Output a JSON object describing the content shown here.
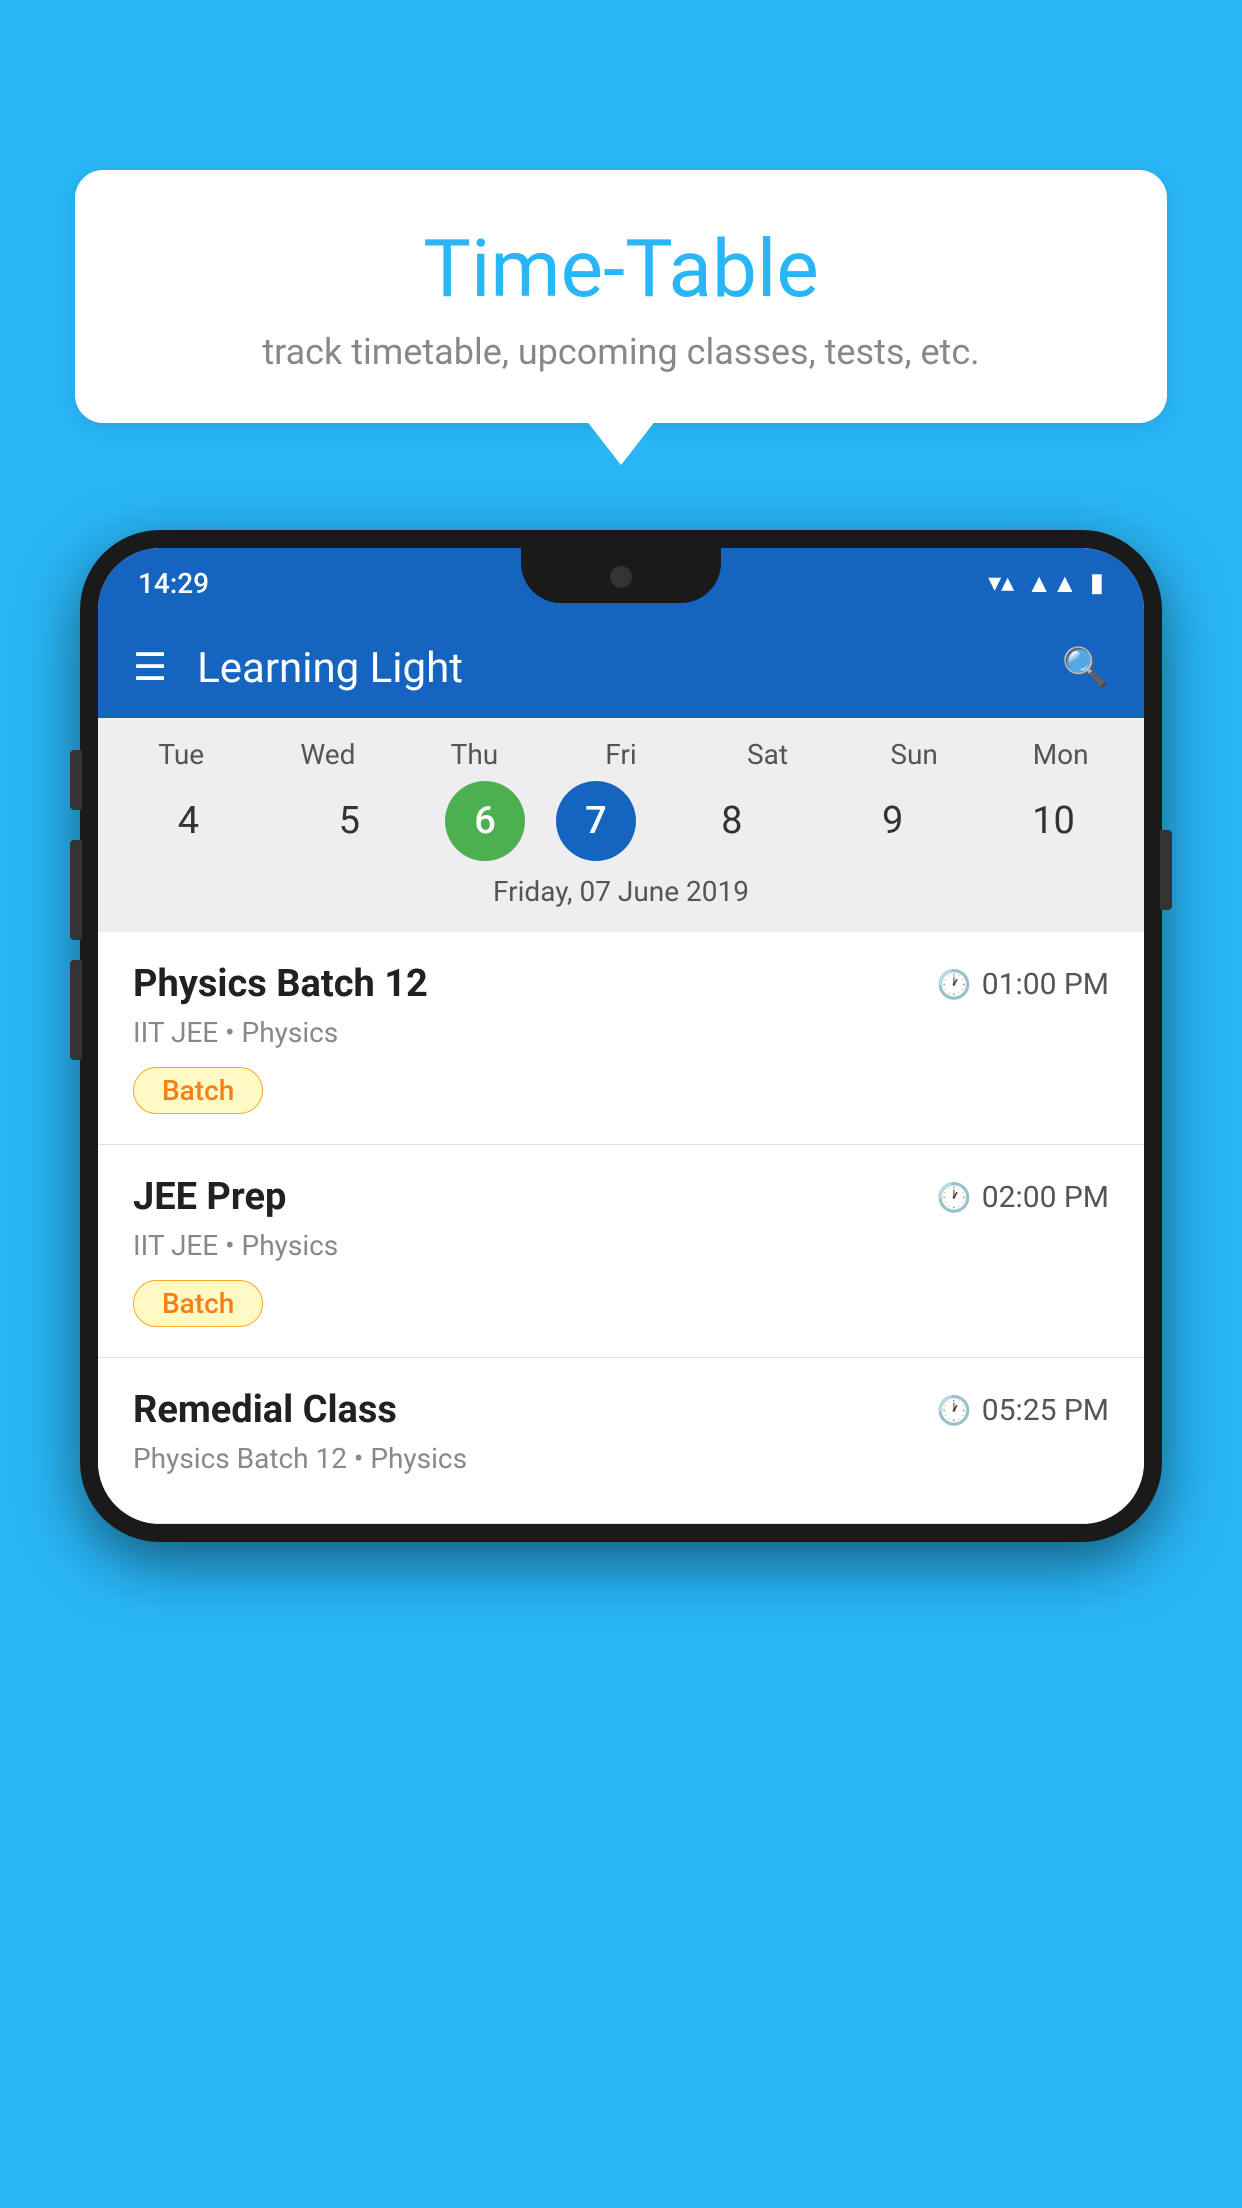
{
  "background_color": "#29B6F6",
  "bubble": {
    "title": "Time-Table",
    "subtitle": "track timetable, upcoming classes, tests, etc."
  },
  "phone": {
    "status_bar": {
      "time": "14:29",
      "icons": [
        "wifi",
        "signal",
        "battery"
      ]
    },
    "app_bar": {
      "title": "Learning Light"
    },
    "calendar": {
      "day_labels": [
        "Tue",
        "Wed",
        "Thu",
        "Fri",
        "Sat",
        "Sun",
        "Mon"
      ],
      "day_numbers": [
        "4",
        "5",
        "6",
        "7",
        "8",
        "9",
        "10"
      ],
      "today_index": 2,
      "selected_index": 3,
      "selected_date_label": "Friday, 07 June 2019"
    },
    "timetable": [
      {
        "name": "Physics Batch 12",
        "time": "01:00 PM",
        "subtitle": "IIT JEE • Physics",
        "badge": "Batch"
      },
      {
        "name": "JEE Prep",
        "time": "02:00 PM",
        "subtitle": "IIT JEE • Physics",
        "badge": "Batch"
      },
      {
        "name": "Remedial Class",
        "time": "05:25 PM",
        "subtitle": "Physics Batch 12 • Physics",
        "badge": null
      }
    ]
  }
}
